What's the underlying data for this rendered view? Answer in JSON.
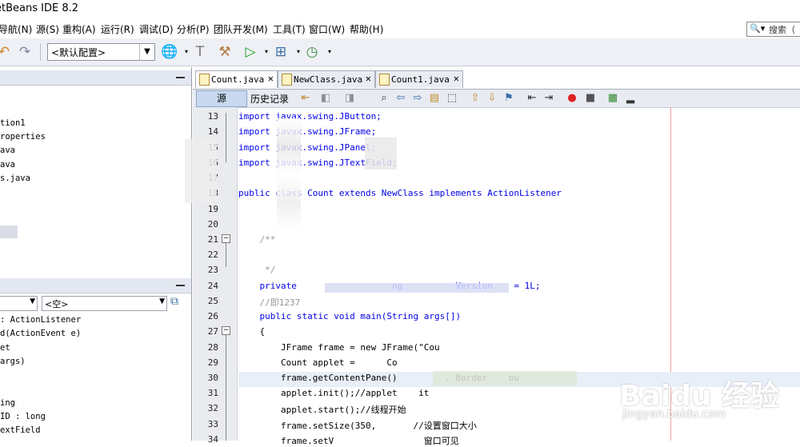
{
  "window": {
    "title": "etBeans IDE 8.2"
  },
  "menubar": {
    "items": [
      "导航(N)",
      "源(S)",
      "重构(A)",
      "运行(R)",
      "调试(D)",
      "分析(P)",
      "团队开发(M)",
      "工具(T)",
      "窗口(W)",
      "帮助(H)"
    ],
    "search_label": "搜索（"
  },
  "toolbar": {
    "config_value": "<默认配置>"
  },
  "project_tree": {
    "items": [
      "tion1",
      "roperties",
      "ava",
      "ava",
      "s.java"
    ]
  },
  "navigator": {
    "filter_value": "<空>",
    "members": [
      ": ActionListener",
      "d(ActionEvent e)",
      "et",
      "args)",
      "",
      "ing",
      "ID : long",
      "extField"
    ]
  },
  "editor": {
    "tabs": [
      {
        "label": "Count.java",
        "active": true
      },
      {
        "label": "NewClass.java",
        "active": false
      },
      {
        "label": "Count1.java",
        "active": false
      }
    ],
    "source_label": "源",
    "history_label": "历史记录",
    "line_numbers": [
      "13",
      "14",
      "15",
      "16",
      "17",
      "18",
      "19",
      "20",
      "21",
      "22",
      "23",
      "24",
      "25",
      "26",
      "27",
      "28",
      "29",
      "30",
      "31",
      "32",
      "33",
      "34"
    ],
    "code_lines": [
      "import javax.swing.JButton;",
      "import javax.swing.JFrame;",
      "import javax.swing.JPanel;",
      "import javax.swing.JTextField;",
      "",
      "public class Count extends NewClass implements ActionListener",
      "",
      "",
      "    /**",
      "",
      "     */",
      "    private                  ng          Version    = 1L;",
      "    //即1237",
      "    public static void main(String args[])",
      "    {",
      "        JFrame frame = new JFrame(\"Cou",
      "        Count applet =      Co",
      "        frame.getContentPane()         . Border    ou",
      "        applet.init();//applet    it",
      "        applet.start();//线程开始",
      "        frame.setSize(350,       //设置窗口大小",
      "        frame.setV                 窗口可见"
    ]
  },
  "watermark": {
    "brand": "Baidu 经验",
    "url": "jingyan.baidu.com"
  }
}
